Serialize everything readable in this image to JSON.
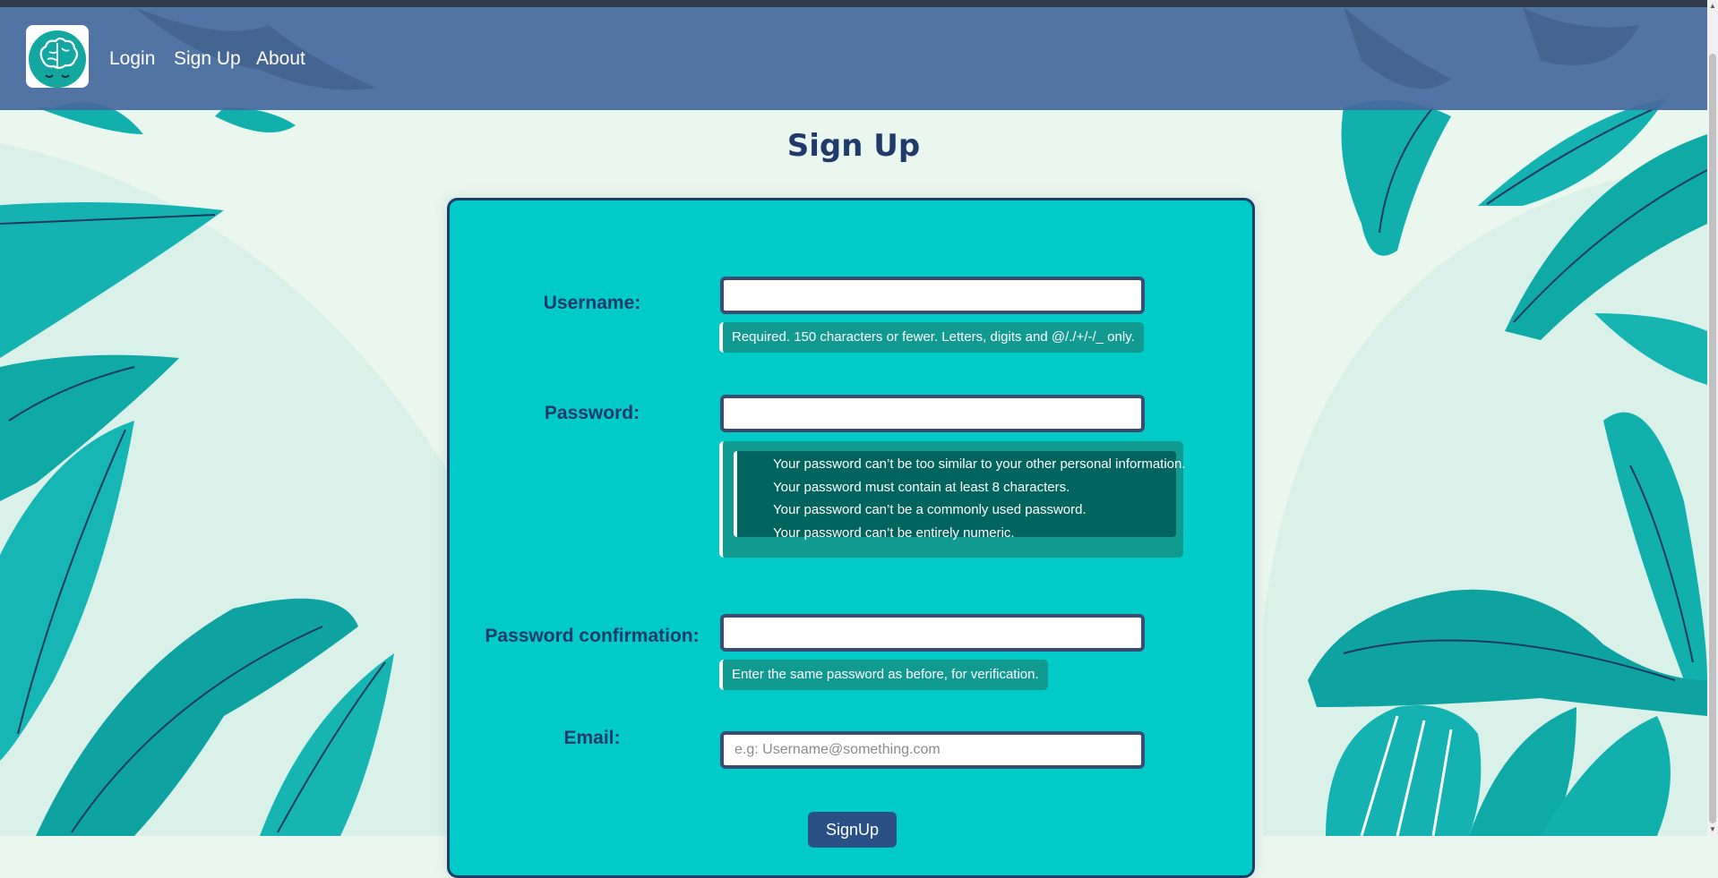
{
  "nav": {
    "links": [
      "Login",
      "Sign Up",
      "About"
    ]
  },
  "page": {
    "title": "Sign Up"
  },
  "form": {
    "username_label": "Username:",
    "username_help": "Required. 150 characters or fewer. Letters, digits and @/./+/-/_ only.",
    "password_label": "Password:",
    "password_help": [
      "Your password can’t be too similar to your other personal information.",
      "Your password must contain at least 8 characters.",
      "Your password can’t be a commonly used password.",
      "Your password can’t be entirely numeric."
    ],
    "password_confirmation_label": "Password confirmation:",
    "password_confirmation_help": "Enter the same password as before, for verification.",
    "email_label": "Email:",
    "email_placeholder": "e.g: Username@something.com",
    "submit_label": "SignUp"
  },
  "colors": {
    "navbar": "#46699e",
    "card": "#00cbc8",
    "leaf": "#12b3b0",
    "title": "#1f3a6b",
    "button": "#2a5085"
  },
  "icons": {
    "logo": "brain-icon"
  }
}
